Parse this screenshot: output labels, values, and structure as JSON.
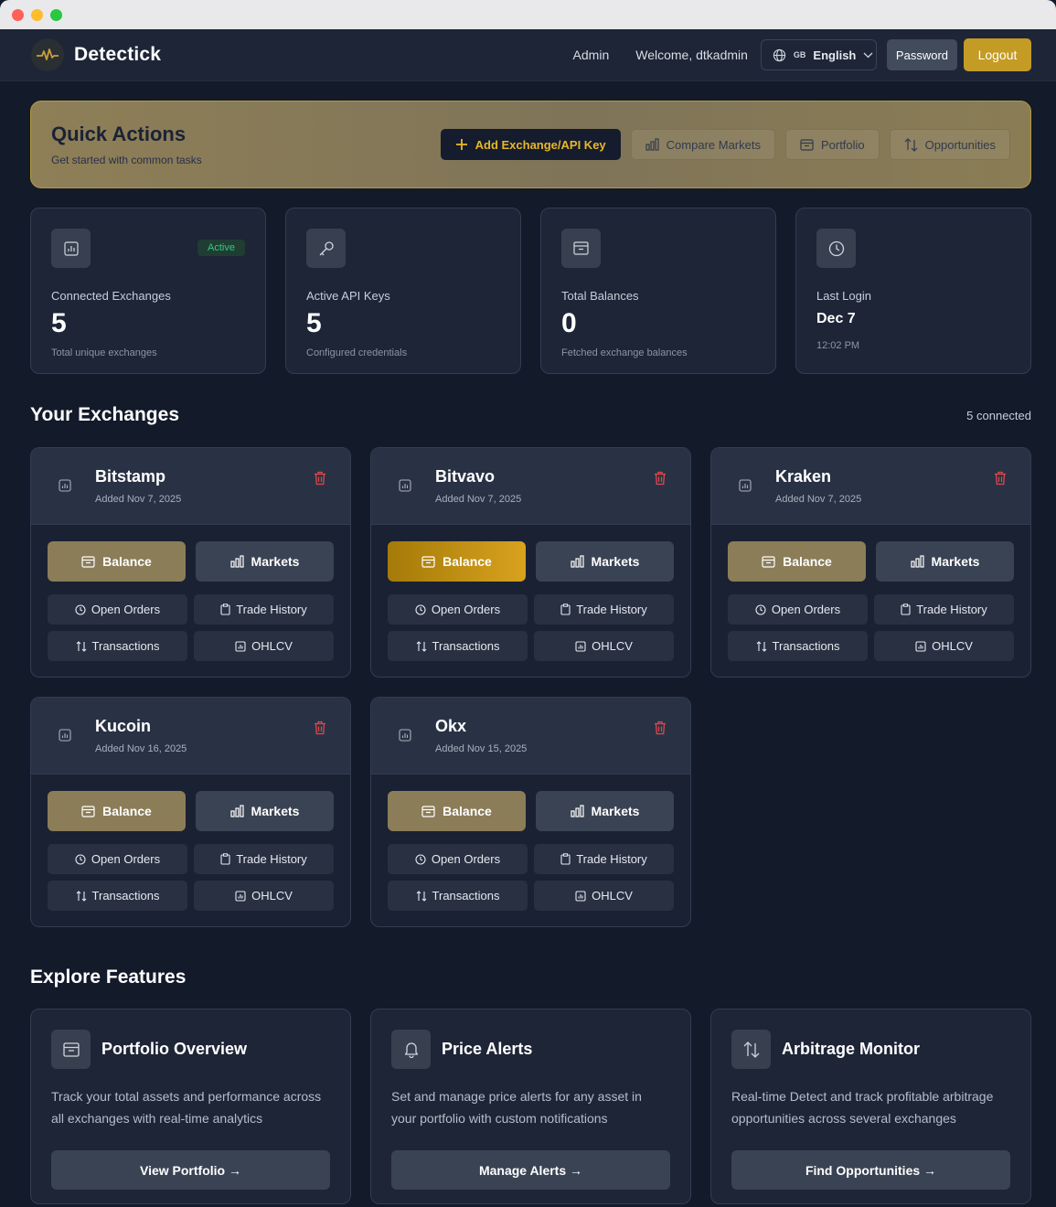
{
  "brand": {
    "name": "Detectick"
  },
  "nav": {
    "admin": "Admin",
    "welcome": "Welcome, dtkadmin",
    "language_flag": "GB",
    "language": "English",
    "password": "Password",
    "logout": "Logout"
  },
  "quick_actions": {
    "title": "Quick Actions",
    "subtitle": "Get started with common tasks",
    "buttons": {
      "add": "Add Exchange/API Key",
      "compare": "Compare Markets",
      "portfolio": "Portfolio",
      "opportunities": "Opportunities"
    }
  },
  "stats": [
    {
      "label": "Connected Exchanges",
      "value": "5",
      "foot": "Total unique exchanges",
      "badge": "Active"
    },
    {
      "label": "Active API Keys",
      "value": "5",
      "foot": "Configured credentials"
    },
    {
      "label": "Total Balances",
      "value": "0",
      "foot": "Fetched exchange balances"
    },
    {
      "label": "Last Login",
      "value": "Dec 7",
      "foot": "12:02 PM"
    }
  ],
  "exchanges_section": {
    "title": "Your Exchanges",
    "meta": "5 connected"
  },
  "exchange_buttons": {
    "balance": "Balance",
    "markets": "Markets",
    "open_orders": "Open Orders",
    "trade_history": "Trade History",
    "transactions": "Transactions",
    "ohlcv": "OHLCV"
  },
  "exchanges": [
    {
      "name": "Bitstamp",
      "added": "Added Nov 7, 2025"
    },
    {
      "name": "Bitvavo",
      "added": "Added Nov 7, 2025"
    },
    {
      "name": "Kraken",
      "added": "Added Nov 7, 2025"
    },
    {
      "name": "Kucoin",
      "added": "Added Nov 16, 2025"
    },
    {
      "name": "Okx",
      "added": "Added Nov 15, 2025"
    }
  ],
  "features_section": {
    "title": "Explore Features"
  },
  "features": [
    {
      "title": "Portfolio Overview",
      "desc": "Track your total assets and performance across all exchanges with real-time analytics",
      "button": "View Portfolio →"
    },
    {
      "title": "Price Alerts",
      "desc": "Set and manage price alerts for any asset in your portfolio with custom notifications",
      "button": "Manage Alerts →"
    },
    {
      "title": "Arbitrage Monitor",
      "desc": "Real-time Detect and track profitable arbitrage opportunities across several exchanges",
      "button": "Find Opportunities →"
    }
  ],
  "colors": {
    "accent": "#c49b24",
    "background": "#131a2a",
    "card": "#1d2536"
  }
}
